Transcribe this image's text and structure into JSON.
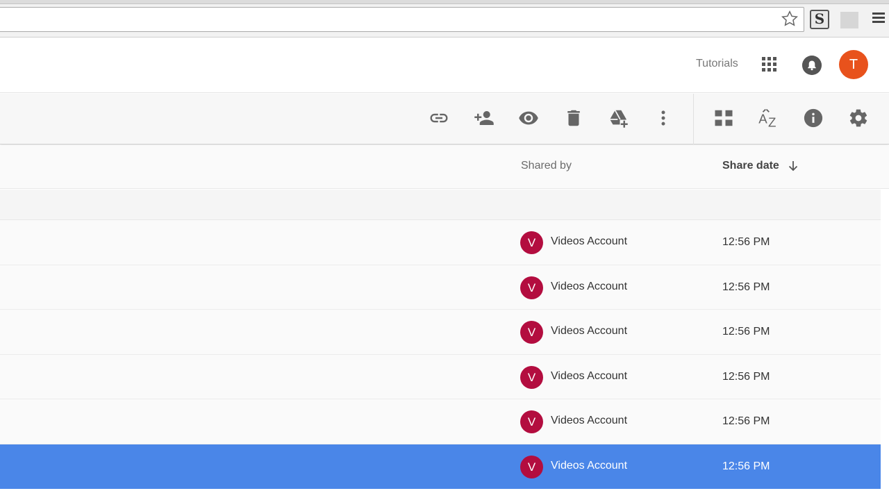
{
  "browser": {
    "icons": [
      "star-icon",
      "s-extension-icon",
      "extension-icon",
      "chrome-menu-icon"
    ],
    "extension_letter": "S"
  },
  "header": {
    "account_label": "Tutorials",
    "avatar_letter": "T",
    "avatar_color": "#e8521c",
    "icons": [
      "apps-grid-icon",
      "notifications-bell-icon"
    ]
  },
  "toolbar": {
    "actions": [
      "get-link-icon",
      "share-person-add-icon",
      "preview-eye-icon",
      "delete-trash-icon",
      "add-to-drive-icon",
      "more-vertical-icon"
    ],
    "view_actions": [
      "grid-view-icon",
      "sort-az-icon",
      "details-info-icon",
      "settings-gear-icon"
    ]
  },
  "list": {
    "columns": {
      "shared_by": "Shared by",
      "share_date": "Share date"
    },
    "sort_direction": "descending",
    "rows": [
      {
        "avatar_letter": "V",
        "shared_by": "Videos Account",
        "date": "12:56 PM",
        "selected": false
      },
      {
        "avatar_letter": "V",
        "shared_by": "Videos Account",
        "date": "12:56 PM",
        "selected": false
      },
      {
        "avatar_letter": "V",
        "shared_by": "Videos Account",
        "date": "12:56 PM",
        "selected": false
      },
      {
        "avatar_letter": "V",
        "shared_by": "Videos Account",
        "date": "12:56 PM",
        "selected": false
      },
      {
        "avatar_letter": "V",
        "shared_by": "Videos Account",
        "date": "12:56 PM",
        "selected": false
      },
      {
        "avatar_letter": "V",
        "shared_by": "Videos Account",
        "date": "12:56 PM",
        "selected": true
      }
    ],
    "owner_avatar_color": "#b30d3f",
    "selected_row_color": "#4a86e8"
  }
}
